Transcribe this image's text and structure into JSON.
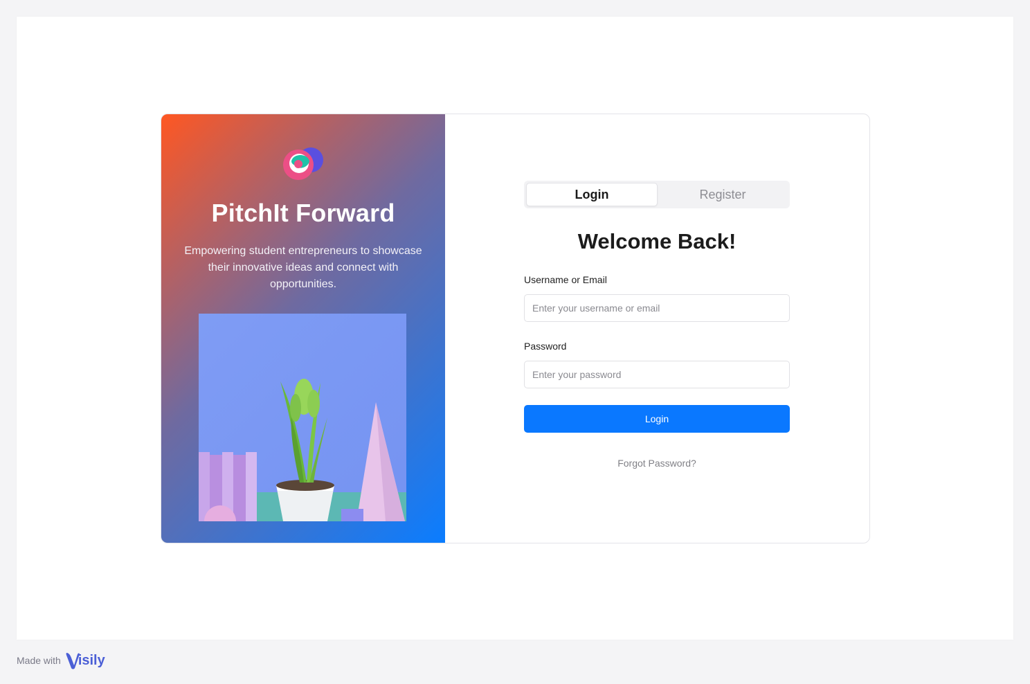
{
  "hero": {
    "brand": "PitchIt Forward",
    "tagline": "Empowering student entrepreneurs to showcase their innovative ideas and connect with opportunities."
  },
  "tabs": [
    {
      "label": "Login",
      "active": true
    },
    {
      "label": "Register",
      "active": false
    }
  ],
  "form": {
    "heading": "Welcome Back!",
    "username_label": "Username or Email",
    "username_placeholder": "Enter your username or email",
    "password_label": "Password",
    "password_placeholder": "Enter your password",
    "submit_label": "Login",
    "forgot_label": "Forgot Password?"
  },
  "footer": {
    "made_with": "Made with",
    "brand": "isily"
  },
  "colors": {
    "primary": "#0a78ff",
    "gradient_start": "#ff5722",
    "gradient_end": "#0a7dff"
  }
}
